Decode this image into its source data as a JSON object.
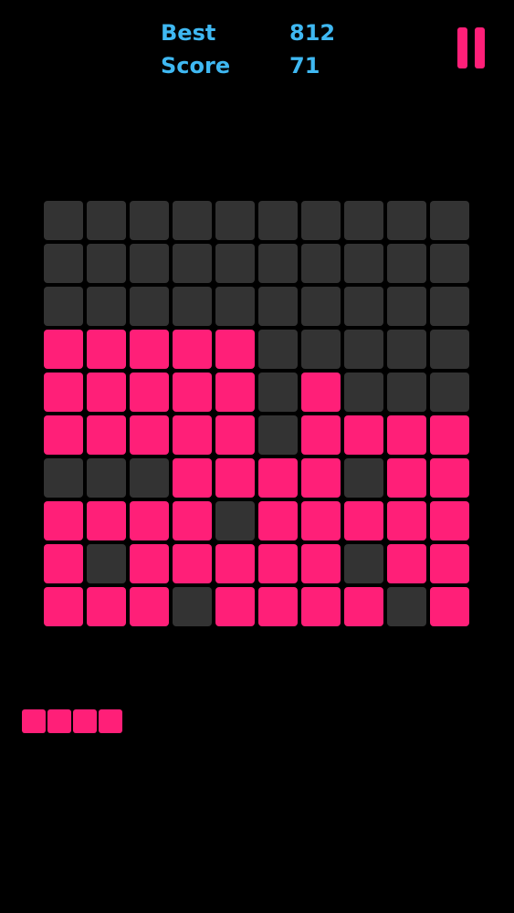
{
  "hud": {
    "best_label": "Best",
    "best_value": "812",
    "score_label": "Score",
    "score_value": "71"
  },
  "colors": {
    "background": "#000000",
    "accent_text": "#3FB8F2",
    "filled": "#FF1F78",
    "empty": "#333333",
    "pause": "#FF1F78"
  },
  "icons": {
    "pause": "pause-icon"
  },
  "board": {
    "rows": 10,
    "cols": 10,
    "grid": [
      [
        0,
        0,
        0,
        0,
        0,
        0,
        0,
        0,
        0,
        0
      ],
      [
        0,
        0,
        0,
        0,
        0,
        0,
        0,
        0,
        0,
        0
      ],
      [
        0,
        0,
        0,
        0,
        0,
        0,
        0,
        0,
        0,
        0
      ],
      [
        1,
        1,
        1,
        1,
        1,
        0,
        0,
        0,
        0,
        0
      ],
      [
        1,
        1,
        1,
        1,
        1,
        0,
        1,
        0,
        0,
        0
      ],
      [
        1,
        1,
        1,
        1,
        1,
        0,
        1,
        1,
        1,
        1
      ],
      [
        0,
        0,
        0,
        1,
        1,
        1,
        1,
        0,
        1,
        1
      ],
      [
        1,
        1,
        1,
        1,
        0,
        1,
        1,
        1,
        1,
        1
      ],
      [
        1,
        0,
        1,
        1,
        1,
        1,
        1,
        0,
        1,
        1
      ],
      [
        1,
        1,
        1,
        0,
        1,
        1,
        1,
        1,
        0,
        1
      ]
    ]
  },
  "next_piece": {
    "shape": "horizontal-bar",
    "blocks": 4
  }
}
